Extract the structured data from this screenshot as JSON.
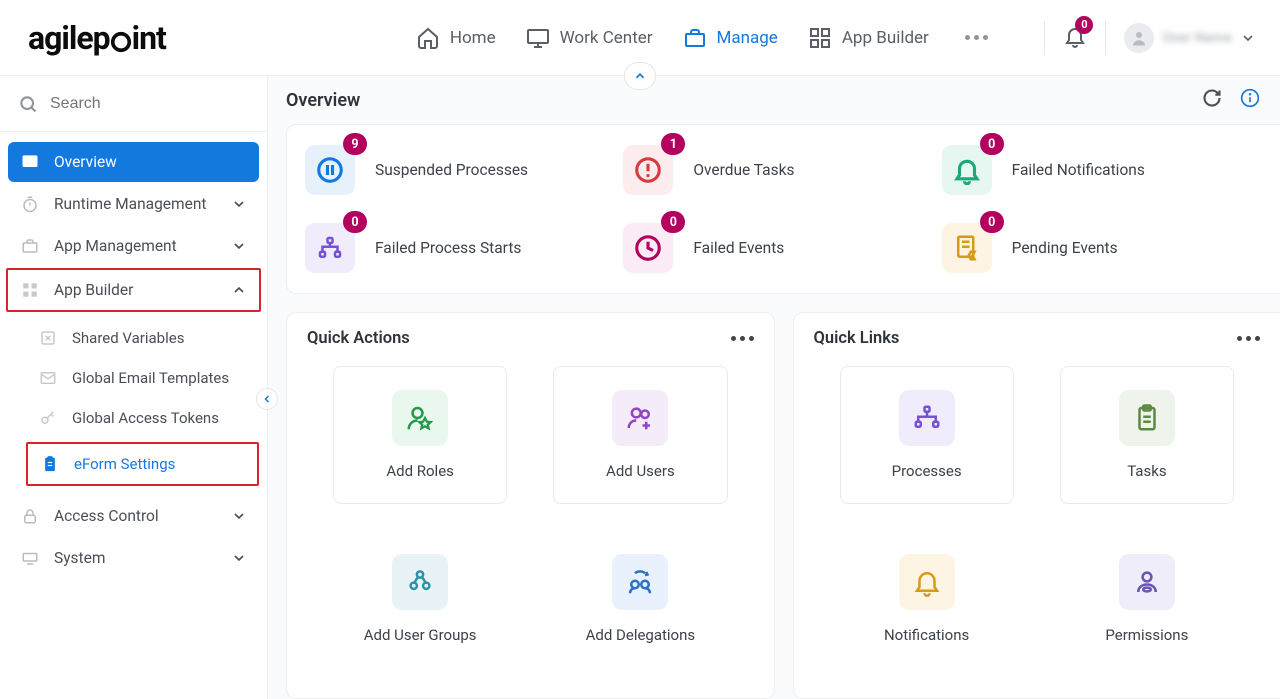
{
  "topnav": {
    "items": [
      {
        "label": "Home"
      },
      {
        "label": "Work Center"
      },
      {
        "label": "Manage",
        "active": true
      },
      {
        "label": "App Builder"
      }
    ],
    "notification_count": 0,
    "user_name": "User Name"
  },
  "sidebar": {
    "search_placeholder": "Search",
    "overview": "Overview",
    "runtime": "Runtime Management",
    "appmgmt": "App Management",
    "appbuilder": "App Builder",
    "sub": {
      "shared_vars": "Shared Variables",
      "email_tpl": "Global Email Templates",
      "tokens": "Global Access Tokens",
      "eform": "eForm Settings"
    },
    "access": "Access Control",
    "system": "System"
  },
  "page": {
    "title": "Overview"
  },
  "stats": [
    {
      "label": "Suspended Processes",
      "count": 9,
      "bg": "#e6f1fb",
      "color": "#1479de",
      "icon": "pause"
    },
    {
      "label": "Overdue Tasks",
      "count": 1,
      "bg": "#fdeced",
      "color": "#d63a43",
      "icon": "alert"
    },
    {
      "label": "Failed Notifications",
      "count": 0,
      "bg": "#e6f6f1",
      "color": "#1aa97a",
      "icon": "bell"
    },
    {
      "label": "Failed Process Starts",
      "count": 0,
      "bg": "#f0ecfb",
      "color": "#7651d3",
      "icon": "chart"
    },
    {
      "label": "Failed Events",
      "count": 0,
      "bg": "#fbebf5",
      "color": "#b3005e",
      "icon": "clock"
    },
    {
      "label": "Pending Events",
      "count": 0,
      "bg": "#fdf4e3",
      "color": "#d69a16",
      "icon": "pending"
    }
  ],
  "quick_actions": {
    "title": "Quick Actions",
    "tiles": [
      {
        "label": "Add Roles",
        "bg": "#eaf7ee",
        "color": "#24984b",
        "icon": "role"
      },
      {
        "label": "Add Users",
        "bg": "#f4edf9",
        "color": "#9145c4",
        "icon": "users"
      },
      {
        "label": "Add User Groups",
        "bg": "#e7f3f6",
        "color": "#2a92a5",
        "icon": "group"
      },
      {
        "label": "Add Delegations",
        "bg": "#e9f2fc",
        "color": "#2a6fc9",
        "icon": "delegate"
      }
    ]
  },
  "quick_links": {
    "title": "Quick Links",
    "tiles": [
      {
        "label": "Processes",
        "bg": "#f0ecfb",
        "color": "#7651d3",
        "icon": "process"
      },
      {
        "label": "Tasks",
        "bg": "#eef3ec",
        "color": "#5a8a3f",
        "icon": "task"
      },
      {
        "label": "Notifications",
        "bg": "#fdf4e3",
        "color": "#d69a16",
        "icon": "notif"
      },
      {
        "label": "Permissions",
        "bg": "#efedf9",
        "color": "#6a54b8",
        "icon": "perm"
      }
    ]
  }
}
